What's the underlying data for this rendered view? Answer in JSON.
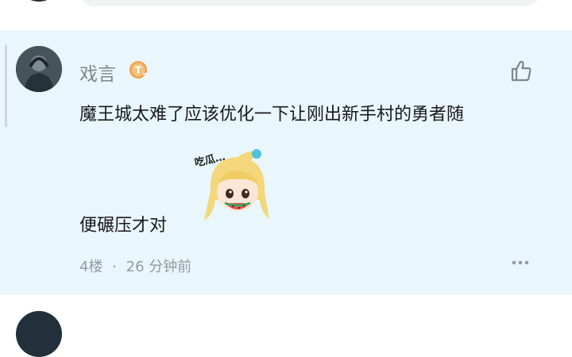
{
  "comment": {
    "username": "戏言",
    "level": "T5",
    "text_line1": "魔王城太难了应该优化一下让刚出新手村的勇者随",
    "text_line2": "便碾压才对",
    "floor": "4楼",
    "separator": "·",
    "time": "26 分钟前",
    "sticker_text": "吃瓜…",
    "icons": {
      "like": "thumbs-up-icon",
      "more": "more-dots-icon",
      "level": "level-badge-icon"
    }
  },
  "colors": {
    "highlight_bg": "#e9f6fb",
    "username": "#7f8591",
    "meta": "#9499a0",
    "badge": "#f0a04b"
  }
}
